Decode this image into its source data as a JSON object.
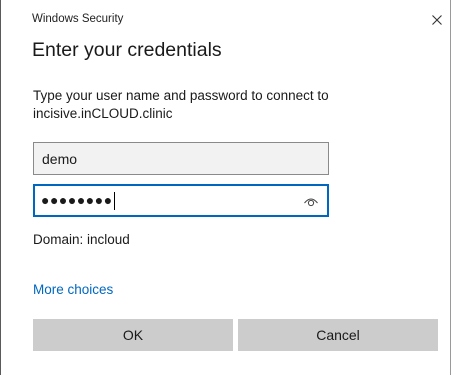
{
  "window": {
    "title": "Windows Security",
    "close_icon": "close-icon"
  },
  "dialog": {
    "heading": "Enter your credentials",
    "message_line1": "Type your user name and password to connect to",
    "message_line2": "incisive.inCLOUD.clinic"
  },
  "fields": {
    "username_value": "demo",
    "password_masked": "●●●●●●●●",
    "reveal_icon": "eye-icon"
  },
  "domain_text": "Domain: incloud",
  "links": {
    "more_choices": "More choices"
  },
  "buttons": {
    "ok": "OK",
    "cancel": "Cancel"
  },
  "colors": {
    "accent": "#0067c0",
    "button_bg": "#cccccc",
    "input_bg": "#f2f2f2"
  }
}
